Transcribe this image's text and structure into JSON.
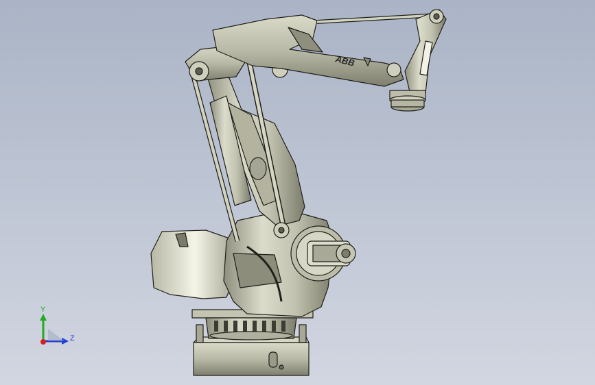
{
  "viewport": {
    "background_top": "#aab4c6",
    "background_bottom": "#d2d6e1",
    "model_name": "robot-arm"
  },
  "model": {
    "brand_label": "ABB",
    "body_color": "#c9c9b6",
    "shadow_color": "#8a8a78",
    "edge_color": "#1f1f1a"
  },
  "triad": {
    "y_label": "Y",
    "z_label": "Z",
    "y_color": "#22aa22",
    "z_color": "#1f3fd6",
    "x_color": "#d42020"
  }
}
